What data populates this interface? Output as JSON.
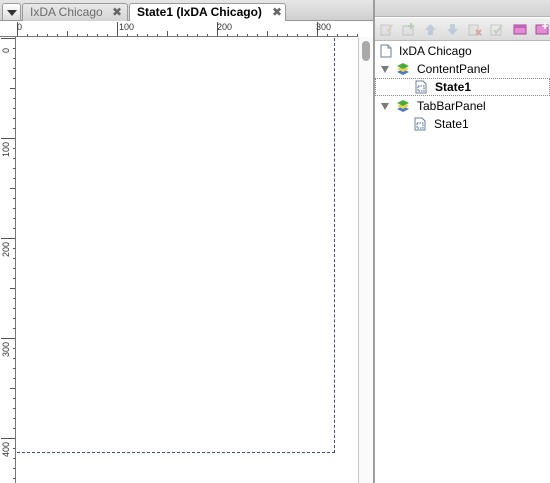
{
  "tabs": [
    {
      "label": "IxDA Chicago",
      "close": "✖",
      "active": false
    },
    {
      "label": "State1 (IxDA Chicago)",
      "close": "✖",
      "active": true
    }
  ],
  "tab_menu_icon": "triangle-down-icon",
  "ruler": {
    "horizontal_labels": [
      "0",
      "100",
      "200",
      "300"
    ],
    "vertical_labels": [
      "0",
      "100",
      "200",
      "300",
      "400"
    ]
  },
  "toolbar": {
    "tools": [
      {
        "icon": "edit-icon",
        "enabled": false
      },
      {
        "icon": "add-icon",
        "enabled": false
      },
      {
        "icon": "move-up-icon",
        "enabled": false
      },
      {
        "icon": "move-down-icon",
        "enabled": false
      },
      {
        "icon": "delete-icon",
        "enabled": false
      },
      {
        "icon": "properties-icon",
        "enabled": false
      },
      {
        "icon": "add-panel-icon",
        "enabled": true
      },
      {
        "icon": "add-state-icon",
        "enabled": true
      }
    ]
  },
  "tree": {
    "root": {
      "label": "IxDA Chicago",
      "icon": "page-icon"
    },
    "panels": [
      {
        "label": "ContentPanel",
        "icon": "dynamic-panel-icon",
        "expanded": true,
        "states": [
          {
            "label": "State1",
            "icon": "state-icon",
            "selected": true
          }
        ]
      },
      {
        "label": "TabBarPanel",
        "icon": "dynamic-panel-icon",
        "expanded": true,
        "states": [
          {
            "label": "State1",
            "icon": "state-icon",
            "selected": false
          }
        ]
      }
    ]
  },
  "colors": {
    "page_outline": "#3d4f7a",
    "panel_icon_green": "#4caa3c",
    "panel_icon_yellow": "#e8d54a",
    "panel_icon_blue": "#4a7ac8"
  }
}
